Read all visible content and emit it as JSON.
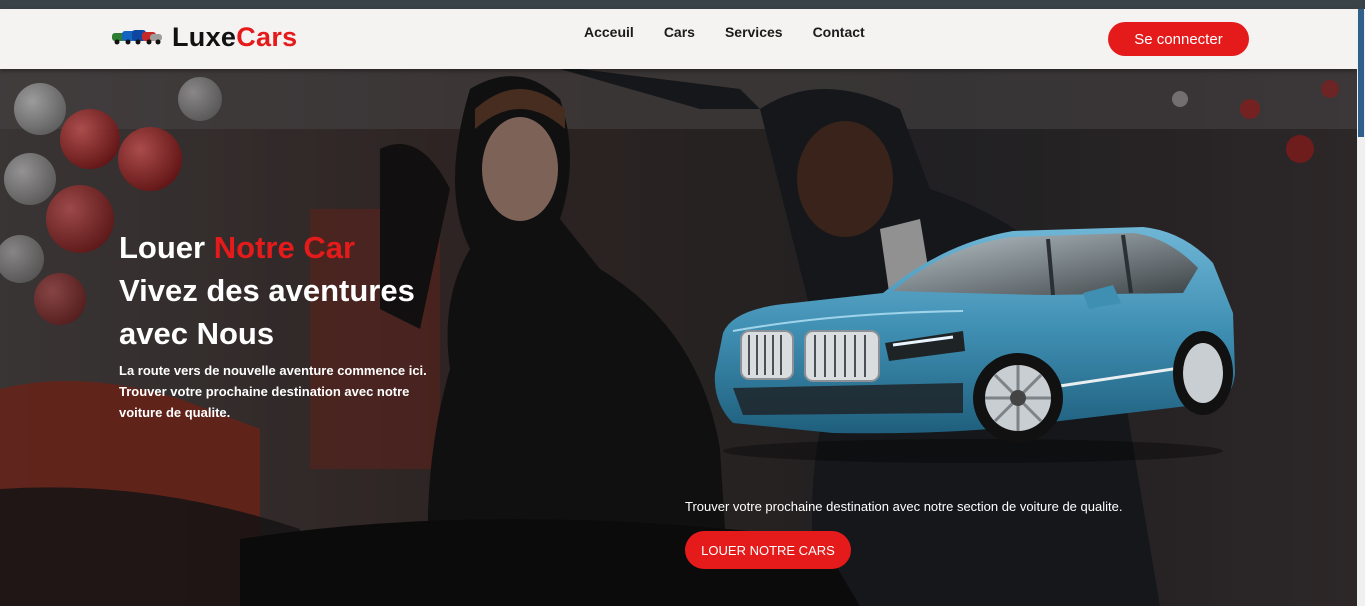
{
  "brand": {
    "part1": "Luxe",
    "part2": "Cars"
  },
  "nav": {
    "items": [
      "Acceuil",
      "Cars",
      "Services",
      "Contact"
    ]
  },
  "header": {
    "login_label": "Se connecter"
  },
  "hero": {
    "headline_word1": "Louer",
    "headline_red": "Notre Car",
    "headline_line2": "Vivez des aventures",
    "headline_line3": "avec Nous",
    "sub_lines": [
      "La route vers de nouvelle aventure commence ici.",
      "Trouver votre prochaine destination avec notre",
      "voiture de qualite."
    ],
    "tagline": "Trouver votre prochaine destination avec notre section de voiture de qualite.",
    "cta_label": "LOUER NOTRE CARS"
  },
  "colors": {
    "accent": "#e51b1b",
    "nav_bg": "#f5f2f2",
    "car_body": "#3f8fb3"
  },
  "icons": [
    "logo-cars-icon",
    "hero-photo",
    "car-image"
  ]
}
